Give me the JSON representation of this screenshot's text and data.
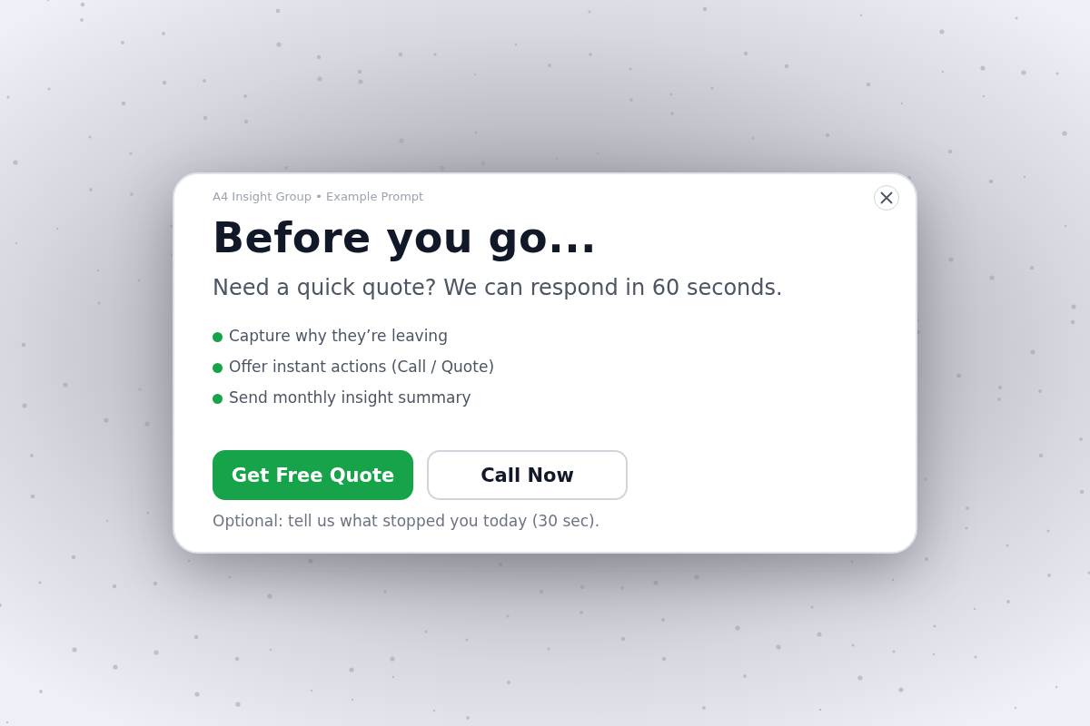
{
  "dialog": {
    "eyebrow": "A4 Insight Group • Example Prompt",
    "title": "Before you go...",
    "subtitle": "Need a quick quote? We can respond in 60 seconds.",
    "bullets": [
      "Capture why they’re leaving",
      "Offer instant actions (Call / Quote)",
      "Send monthly insight summary"
    ],
    "buttons": [
      {
        "label": "Get Free Quote",
        "kind": "primary"
      },
      {
        "label": "Call Now",
        "kind": "secondary"
      }
    ],
    "footnote": "Optional: tell us what stopped you today (30 sec)."
  }
}
